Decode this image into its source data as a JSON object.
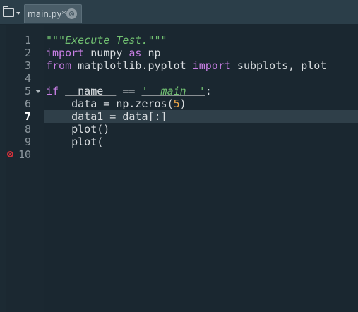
{
  "tabs": [
    {
      "label": "main.py*",
      "close": "⊗"
    }
  ],
  "line_numbers": [
    "1",
    "2",
    "3",
    "4",
    "5",
    "6",
    "7",
    "8",
    "9",
    "10"
  ],
  "current_line": "7",
  "code": {
    "l1": {
      "doc": "\"\"\"Execute Test.\"\"\""
    },
    "l2": {
      "kw1": "import",
      "t1": " numpy ",
      "kw2": "as",
      "t2": " np"
    },
    "l3": {
      "kw1": "from",
      "t1": " matplotlib.pyplot ",
      "kw2": "import",
      "t2": " subplots, plot"
    },
    "l5": {
      "kw1": "if",
      "t1": " ",
      "name": "__name__",
      "t2": " == ",
      "str": "'__main__'",
      "t3": ":"
    },
    "l6": {
      "t1": "    data = np.zeros(",
      "num": "5",
      "t2": ")"
    },
    "l7": {
      "t1": "    data1 = data[:]"
    },
    "l8": {
      "t1": "    plot()"
    },
    "l9": {
      "t1": "    plot("
    }
  },
  "colors": {
    "keyword": "#c77ee3",
    "string": "#71c071",
    "number": "#f1a94a",
    "error": "#d3303a"
  },
  "icons": {
    "folder": "folder-icon",
    "dropdown": "chevron-down-icon",
    "close": "close-icon",
    "error": "error-icon",
    "fold": "fold-arrow-icon"
  }
}
